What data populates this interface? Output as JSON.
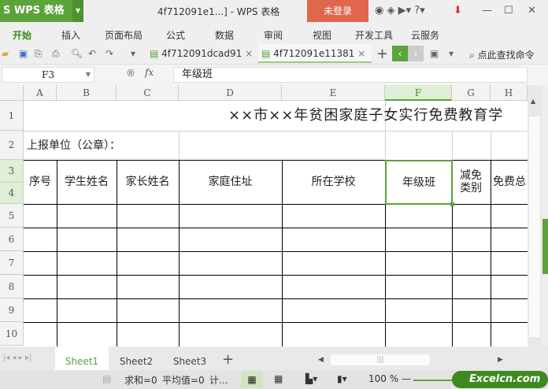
{
  "app": {
    "logo": "S WPS 表格",
    "window_title": "4f712091e1...] - WPS 表格",
    "login": "未登录"
  },
  "menu": [
    "开始",
    "插入",
    "页面布局",
    "公式",
    "数据",
    "审阅",
    "视图",
    "开发工具",
    "云服务"
  ],
  "tabs": [
    {
      "label": "4f712091dcad91"
    },
    {
      "label": "4f712091e11381"
    }
  ],
  "search_cmd": "点此查找命令",
  "formula": {
    "cell_ref": "F3",
    "fx": "fx",
    "value": "年级班"
  },
  "columns": [
    "A",
    "B",
    "C",
    "D",
    "E",
    "F",
    "G",
    "H"
  ],
  "rows": [
    "1",
    "2",
    "3",
    "4",
    "5",
    "6",
    "7",
    "8",
    "9",
    "10"
  ],
  "sheet": {
    "title": "××市××年贫困家庭子女实行免费教育学",
    "unit": "上报单位（公章）：",
    "headers": [
      "序号",
      "学生姓名",
      "家长姓名",
      "家庭住址",
      "所在学校",
      "年级班",
      "减免类别",
      "免费总"
    ]
  },
  "sheets": [
    "Sheet1",
    "Sheet2",
    "Sheet3"
  ],
  "status": {
    "sum": "求和=0",
    "avg": "平均值=0",
    "count": "计...",
    "zoom": "100 %"
  },
  "watermark": "Excelcn.com",
  "colors": {
    "accent": "#5ba33a",
    "login": "#e0674c"
  }
}
